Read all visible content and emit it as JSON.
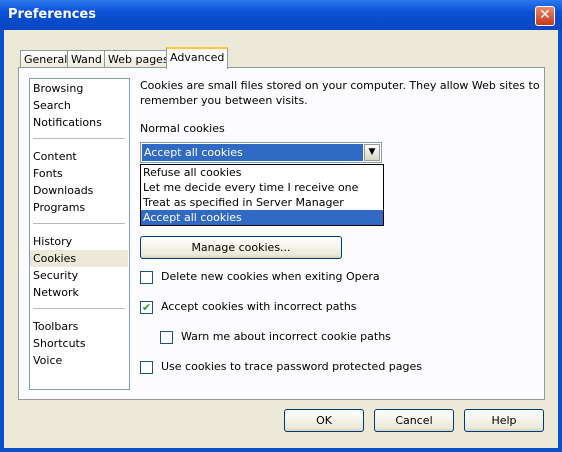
{
  "window": {
    "title": "Preferences"
  },
  "tabs": [
    "General",
    "Wand",
    "Web pages",
    "Advanced"
  ],
  "sidebar": {
    "items": [
      "Browsing",
      "Search",
      "Notifications",
      "Content",
      "Fonts",
      "Downloads",
      "Programs",
      "History",
      "Cookies",
      "Security",
      "Network",
      "Toolbars",
      "Shortcuts",
      "Voice"
    ],
    "selected": "Cookies"
  },
  "cookies": {
    "intro": "Cookies are small files stored on your computer. They allow Web sites to remember you between visits.",
    "normal_label": "Normal cookies",
    "selected_option": "Accept all cookies",
    "options": [
      "Refuse all cookies",
      "Let me decide every time I receive one",
      "Treat as specified in Server Manager",
      "Accept all cookies"
    ],
    "manage_button": "Manage cookies...",
    "checkboxes": [
      {
        "label": "Delete new cookies when exiting Opera",
        "checked": false
      },
      {
        "label": "Accept cookies with incorrect paths",
        "checked": true
      },
      {
        "label": "Warn me about incorrect cookie paths",
        "checked": false
      },
      {
        "label": "Use cookies to trace password protected pages",
        "checked": false
      }
    ]
  },
  "buttons": {
    "ok": "OK",
    "cancel": "Cancel",
    "help": "Help"
  },
  "icons": {
    "close": "close-icon",
    "dropdown": "chevron-down-icon",
    "check": "checkmark-icon"
  }
}
